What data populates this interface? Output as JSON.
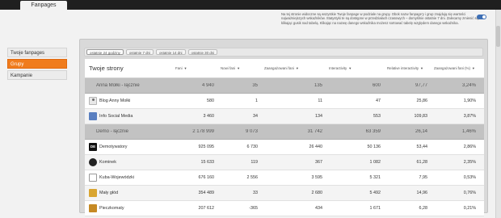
{
  "app": {
    "tab_label": "Fanpages"
  },
  "info": {
    "text": "Na tej stronie widoczne są wszystkie Twoje fanpage w podziale na grupy. Obok nazw fanpage'y i grup znajdują się wartości najważniejszych wskaźników. Statystyki te są dostępne w przedziałach czasowych – domyślnie ostatnie 7 dni. Zalecamy zmienić się klikając gusik nad tabelą. Klikając na nazwę danego wskaźnika możesz sortować tabelę względem danego wskaźnika."
  },
  "sidebar": {
    "items": [
      {
        "label": "Twoje fanpages"
      },
      {
        "label": "Grupy"
      },
      {
        "label": "Kampanie"
      }
    ]
  },
  "periods": [
    {
      "label": "ostatnie 24 godziny"
    },
    {
      "label": "ostatnie 7 dni"
    },
    {
      "label": "ostatnie 14 dni"
    },
    {
      "label": "ostatnie 30 dni"
    }
  ],
  "table": {
    "title": "Twoje strony",
    "headers": {
      "fans": "Fani",
      "new": "Nowi fani",
      "eng": "Zaangażowani fani",
      "int": "Interactivity",
      "rel": "Relative interactivity",
      "pct": "Zaangażowani fani (%)"
    },
    "rows": [
      {
        "name": "Anna Mołki - łącznie",
        "fans": "4 940",
        "new": "35",
        "eng": "135",
        "int": "600",
        "rel": "97,77",
        "pct": "3,24%"
      },
      {
        "name": "Blog Anny Mołki",
        "fans": "580",
        "new": "1",
        "eng": "11",
        "int": "47",
        "rel": "25,86",
        "pct": "1,90%"
      },
      {
        "name": "Info Social Media",
        "fans": "3 460",
        "new": "34",
        "eng": "134",
        "int": "553",
        "rel": "109,83",
        "pct": "3,87%"
      },
      {
        "name": "Demo - łącznie",
        "fans": "2 178 999",
        "new": "9 073",
        "eng": "31 742",
        "int": "63 359",
        "rel": "26,14",
        "pct": "1,46%"
      },
      {
        "name": "Demotywatory",
        "fans": "925 095",
        "new": "6 730",
        "eng": "26 440",
        "int": "50 136",
        "rel": "53,44",
        "pct": "2,86%"
      },
      {
        "name": "Kominek",
        "fans": "15 633",
        "new": "119",
        "eng": "367",
        "int": "1 082",
        "rel": "61,28",
        "pct": "2,35%"
      },
      {
        "name": "Kuba-Wojewódzki",
        "fans": "676 160",
        "new": "2 556",
        "eng": "3 595",
        "int": "5 321",
        "rel": "7,95",
        "pct": "0,53%"
      },
      {
        "name": "Mały głód",
        "fans": "354 489",
        "new": "33",
        "eng": "2 680",
        "int": "5 492",
        "rel": "14,96",
        "pct": "0,76%"
      },
      {
        "name": "Pieczkomaty",
        "fans": "207 612",
        "new": "-365",
        "eng": "434",
        "int": "1 671",
        "rel": "6,28",
        "pct": "0,21%"
      }
    ]
  },
  "colors": {
    "accent": "#f07c1d",
    "group_row": "#c2c2c2",
    "topbar": "#1f1f1f"
  }
}
